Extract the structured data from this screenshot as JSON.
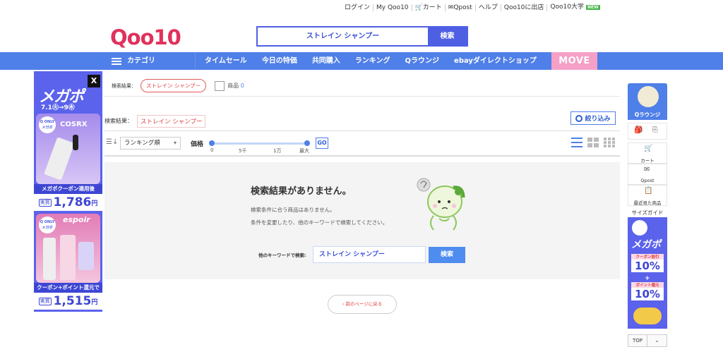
{
  "header": {
    "links": [
      "ログイン",
      "My Qoo10",
      "カート",
      "Qpost",
      "ヘルプ",
      "Qoo10に出店",
      "Qoo10大学"
    ],
    "new_badge": "NEW",
    "logo_a": "Q",
    "logo_b": "oo10"
  },
  "search": {
    "value": "ストレイン シャンプー",
    "button": "検索"
  },
  "nav": {
    "category": "カテゴリ",
    "items": [
      "タイムセール",
      "今日の特価",
      "共同購入",
      "ランキング",
      "Qラウンジ",
      "ebayダイレクトショップ"
    ],
    "move": "MOVE"
  },
  "left_ad": {
    "close": "X",
    "title": "メガポ",
    "date": "7.1㊋→9㊍",
    "qonly_top": "Q ONLY",
    "qonly_bottom": "メガポ",
    "brand1": "COSRX",
    "strip1": "メガポクーポン適用後",
    "price1_tag": "実質",
    "price1": "1,786",
    "yen": "円",
    "brand2": "espoir",
    "strip2": "クーポン+ポイント還元で",
    "price2_tag": "実質",
    "price2": "1,515"
  },
  "result_bar": {
    "label": "検索結果：",
    "keyword": "ストレイン シャンプー",
    "count_label": "商品",
    "count": "0"
  },
  "filter_bar": {
    "label": "検索結果：",
    "keyword": "ストレイン シャンプー",
    "narrow": "絞り込み"
  },
  "sort_bar": {
    "sort_value": "ランキング順",
    "price_label": "価格",
    "ticks": [
      "0",
      "5千",
      "1万",
      "最大"
    ],
    "go": "GO"
  },
  "no_result": {
    "heading": "検索結果がありません。",
    "line1": "検索条件に合う商品はありません。",
    "line2": "条件を変更したり、他のキーワードで検索してください。",
    "keyword_label": "他のキーワードで検索:",
    "keyword_value": "ストレイン シャンプー",
    "button": "検索"
  },
  "back_button": "前のページに戻る",
  "right_rail": {
    "qlounge": "Qラウンジ",
    "cart": "カート",
    "qpost": "Qpost",
    "recent": "最近見た商品",
    "size_guide": "サイズガイド",
    "ad_title": "メガポ",
    "ad_pct1_label": "クーポン割引",
    "ad_pct1": "10%",
    "ad_plus": "+",
    "ad_pct2_label": "ポイント還元",
    "ad_pct2": "10%",
    "top": "TOP"
  },
  "colors": {
    "brand_blue": "#4f7fe8",
    "logo_red": "#e0315c",
    "accent_red": "#e03b3b",
    "ad_purple": "#5b62ec"
  }
}
